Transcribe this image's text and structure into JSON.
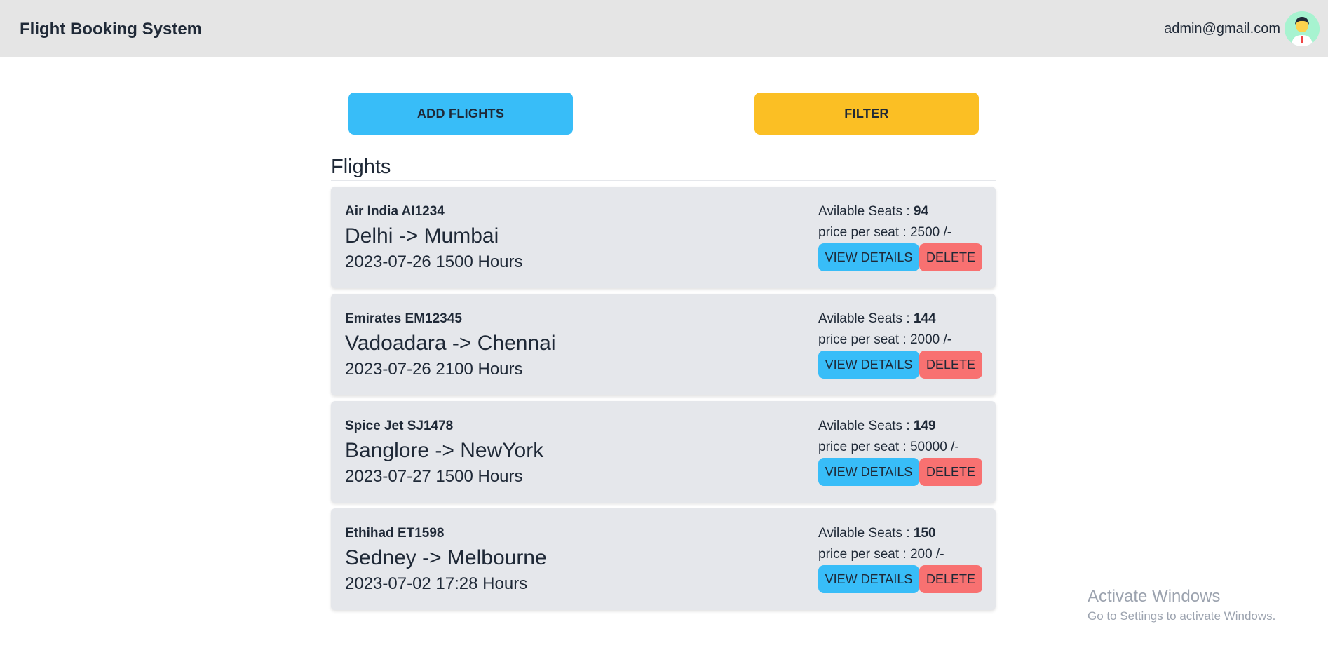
{
  "navbar": {
    "brand": "Flight Booking System",
    "user_email": "admin@gmail.com",
    "avatar_icon": "user-avatar-icon"
  },
  "actions": {
    "add_flights": "ADD FLIGHTS",
    "filter": "FILTER"
  },
  "section": {
    "title": "Flights"
  },
  "labels": {
    "seats_prefix": "Avilable Seats : ",
    "price_prefix": "price per seat : ",
    "price_suffix": " /-",
    "view_details": "VIEW DETAILS",
    "delete": "DELETE"
  },
  "flights": [
    {
      "airline": "Air India AI1234",
      "route": "Delhi -> Mumbai",
      "datetime": "2023-07-26 1500 Hours",
      "seats": "94",
      "price": "2500"
    },
    {
      "airline": "Emirates EM12345",
      "route": "Vadoadara -> Chennai",
      "datetime": "2023-07-26 2100 Hours",
      "seats": "144",
      "price": "2000"
    },
    {
      "airline": "Spice Jet SJ1478",
      "route": "Banglore -> NewYork",
      "datetime": "2023-07-27 1500 Hours",
      "seats": "149",
      "price": "50000"
    },
    {
      "airline": "Ethihad ET1598",
      "route": "Sedney -> Melbourne",
      "datetime": "2023-07-02 17:28 Hours",
      "seats": "150",
      "price": "200"
    }
  ],
  "watermark": {
    "title": "Activate Windows",
    "subtitle": "Go to Settings to activate Windows."
  },
  "colors": {
    "navbar_bg": "#e5e5e5",
    "primary": "#38bdf8",
    "warning": "#fbbf24",
    "danger": "#f87171",
    "card_bg": "#e5e7eb"
  }
}
